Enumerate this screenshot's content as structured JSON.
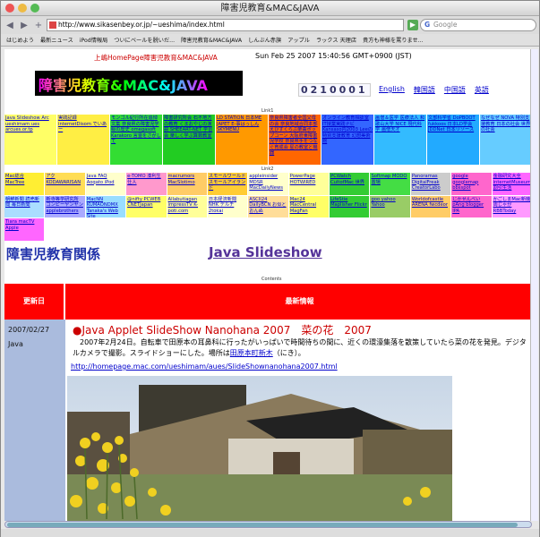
{
  "window": {
    "title": "障害児教育&MAC&JAVA"
  },
  "toolbar": {
    "url": "http://www.sikasenbey.or.jp/~ueshima/index.html",
    "search_placeholder": "Google",
    "back": "◀",
    "forward": "▶",
    "add": "+",
    "go": "▶"
  },
  "bookmarks": [
    "はじめよう",
    "最新ニュース",
    "iPod情報局",
    "ついにベールを脱いだ...",
    "障害児教育&MAC&JAVA",
    "しんぶん赤旗",
    "アップル",
    "ラックス 天理店",
    "貴方も神様を罵りませ..."
  ],
  "page": {
    "header": "上嶋HomePage障害児教育&MAC&JAVA",
    "clock": "Sun Feb 25 2007 15:40:56 GMT+0900 (JST)",
    "banner": "障害児教育&MAC&JAVA",
    "counter": "0210001",
    "langs": [
      "English",
      "韓国語",
      "中国語",
      "英語"
    ],
    "link1_label": "Link1",
    "link2_label": "Link2",
    "contents_label": "Contents",
    "title_left": "障害児教育関係",
    "title_right": "Java Slideshow",
    "table": {
      "col_date": "更新日",
      "col_info": "最新情報",
      "date": "2007/02/27",
      "category": "Java"
    },
    "post": {
      "title": "●Java Applet SlideShow Nanohana 2007　菜の花　2007",
      "body": "　2007年2月24日。自転車で田原本の耳鼻科に行ったがいっぱいで時間待ちの間に、近くの環濠集落を散策していたら菜の花を発見。デジタルカメラで撮影。スライドショーにした。場所は",
      "place": "田原本町新木",
      "suffix": "（にき）。",
      "link": "http://homepage.mac.com/ueshimam/aues/SlideShownanohana2007.html"
    }
  },
  "link1": [
    {
      "t": "Java Slideshow Arc ueshimam ues arcues.or.tp",
      "bg": "#ffff66"
    },
    {
      "t": "実践記録 internetDisom でいあー",
      "bg": "#ffee44"
    },
    {
      "t": "モンゴル紀行所在追悼文集 奈良県の障害児学級の歴史 omegasoft Karakoro 言霊をさがして",
      "bg": "#33dd33"
    },
    {
      "t": "障害研究所会 石不地方の教育 くまおやじの演説 SHEEART-NET 学習会 楽しく学ぶ算数教室",
      "bg": "#22cc22"
    },
    {
      "t": "LD STATION 日本ME JAPET E-事はっしん SKYMENU",
      "bg": "#ff9900"
    },
    {
      "t": "奈良県障害者全国父母の会 奈良地域合同本部 えびすくらぶ楽曲ポップコーン 大阪府東障害児学校 奈良県手をつなぐ育成会 星の教室と機器",
      "bg": "#ff6600"
    },
    {
      "t": "オンライン教育相談室 IT授業実践ナビ Kansaso内2003 Leeの特別支援教育 幻想美術館",
      "bg": "#3366ff"
    },
    {
      "t": "画僧＆医学 医療法人 和歌山大学 NICE 現代科学 画僧天才",
      "bg": "#33bbff"
    },
    {
      "t": "文部科学省 DoPBOOT fukkoos 日本LD学会 JDDNet 日本リソース",
      "bg": "#22aaff"
    },
    {
      "t": "なぜなぜ NOVA 特別支援教育 日本の社会 世界の社会",
      "bg": "#66ccff"
    }
  ],
  "link2": [
    {
      "t": "Mac総合 MacTree",
      "bg": "#ffee33"
    },
    {
      "t": "アク KODAWARISAN",
      "bg": "#ffdd55"
    },
    {
      "t": "Java FAQ Aoqato iPod",
      "bg": "#ffffcc"
    },
    {
      "t": "e-TOMO 湊利生仕人",
      "bg": "#ff99cc"
    },
    {
      "t": "macrumors MacSlotimo",
      "bg": "#ffcc66"
    },
    {
      "t": "スモールワールド スモールアイランド",
      "bg": "#ffcc33"
    },
    {
      "t": "appleinsider MDSR MacDailyNews",
      "bg": "#ffffcc"
    },
    {
      "t": "PowerPage HOTWIRED",
      "bg": "#ffff99"
    },
    {
      "t": "PCWatch CultofMac 世界",
      "bg": "#33cc33"
    },
    {
      "t": "Softmap MODO 置場",
      "bg": "#44dd44"
    },
    {
      "t": "Panoramas DigitalFreak CreatorLabo",
      "bg": "#cccccc"
    },
    {
      "t": "google googlemap bbsspot",
      "bg": "#ff66cc"
    },
    {
      "t": "金融研究大全 internetMuseum 割引生活",
      "bg": "#ff66ff"
    },
    {
      "t": "朝鮮新聞 読売新聞 毎日新聞",
      "bg": "#aaddff"
    },
    {
      "t": "新寺等学研究所 コンピーヤンヤン applebrothers",
      "bg": "#aaaaff"
    },
    {
      "t": "MacNN KUMAONDMX Tanaka's Web Site",
      "bg": "#99ddff"
    },
    {
      "t": "@nifty PCWEB CNETJapan",
      "bg": "#ffff66"
    },
    {
      "t": "Allabutiagan impressTV K-poti.com",
      "bg": "#ffff99"
    },
    {
      "t": "日本経済新聞 NHK デルチ 2tokai",
      "bg": "#ffffcc"
    },
    {
      "t": "ASCII24 DailyBCN お似とおんぬ",
      "bg": "#ffdd99"
    },
    {
      "t": "Mac24 MacCentral MagFan",
      "bg": "#ffff66"
    },
    {
      "t": "LifeStie Maplisher Flickr",
      "bg": "#33cc33"
    },
    {
      "t": "goo yahoo Yahoo",
      "bg": "#99cc66"
    },
    {
      "t": "Worldofcastle ARENA fwcdeor",
      "bg": "#ffcc66"
    },
    {
      "t": "じかせんべい pAng blogger IPA",
      "bg": "#ff66cc"
    },
    {
      "t": "かごしまMac新機 周じゃが RBBToday",
      "bg": "#ff99ff"
    },
    {
      "t": "Tiara macTV Apple",
      "bg": "#ff66ff"
    }
  ],
  "colors": {
    "accent": "#ff0000",
    "left": "#aabbdd",
    "title": "#2233aa"
  }
}
